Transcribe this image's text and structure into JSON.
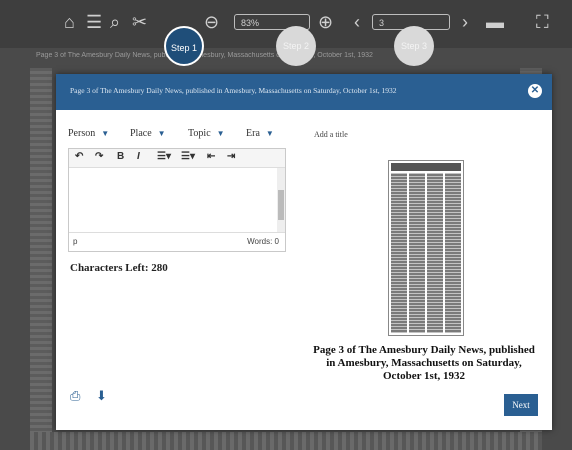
{
  "toolbar": {
    "zoom_value": "83%",
    "page_value": "3"
  },
  "background": {
    "caption": "Page 3 of The Amesbury Daily News, published in Amesbury, Massachusetts on Saturday, October 1st, 1932"
  },
  "steps": [
    {
      "label": "Step 1",
      "active": true
    },
    {
      "label": "Step 2",
      "active": false
    },
    {
      "label": "Step 3",
      "active": false
    }
  ],
  "modal": {
    "title": "Page 3 of The Amesbury Daily News, published in Amesbury, Massachusetts on Saturday, October 1st, 1932",
    "tags": [
      "Person",
      "Place",
      "Topic",
      "Era"
    ],
    "add_title_placeholder": "Add a title",
    "editor": {
      "status_path": "p",
      "words_label": "Words: 0"
    },
    "characters_left": "Characters Left: 280",
    "thumbnail_caption": "Page 3 of The Amesbury Daily News, published in Amesbury, Massachusetts on Saturday, October 1st, 1932",
    "next_label": "Next"
  },
  "colors": {
    "accent": "#2a5f92",
    "step_active": "#1f4e79"
  }
}
